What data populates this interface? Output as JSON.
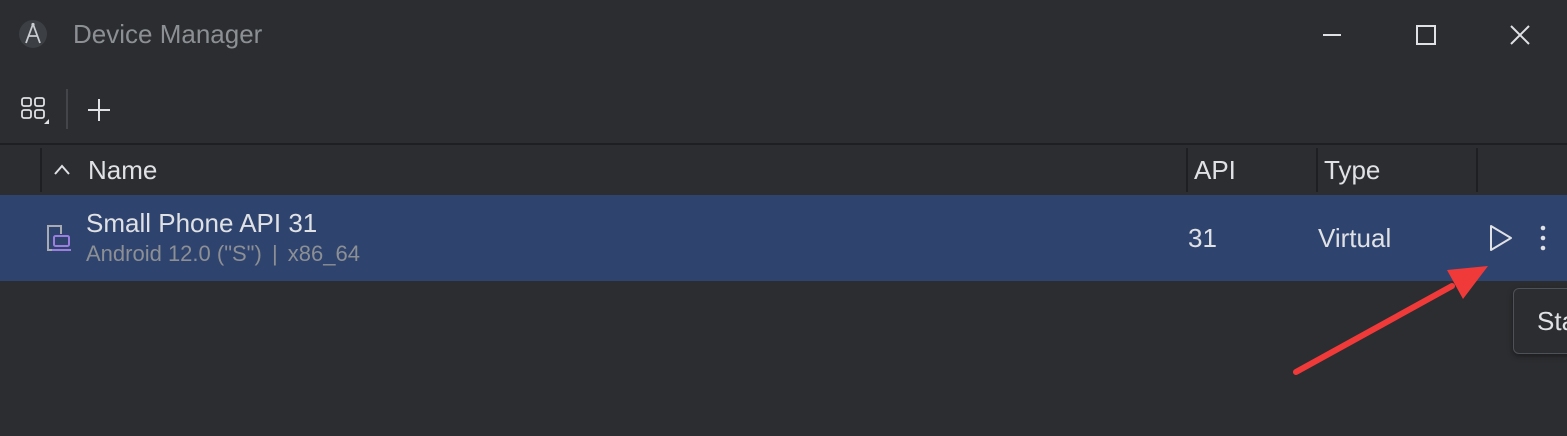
{
  "window": {
    "title": "Device Manager"
  },
  "toolbar": {
    "view_icon": "grid-view-icon",
    "add_icon": "plus-icon"
  },
  "table": {
    "columns": [
      "Name",
      "API",
      "Type"
    ],
    "sort_icon": "chevron-up-icon",
    "rows": [
      {
        "name": "Small Phone API 31",
        "android": "Android 12.0 (\"S\")",
        "arch": "x86_64",
        "api": "31",
        "type": "Virtual",
        "device_icon": "virtual-device-icon",
        "run_icon": "play-icon",
        "more_icon": "more-vertical-icon"
      }
    ]
  },
  "tooltip": {
    "text": "Sta"
  },
  "colors": {
    "background": "#2b2d30",
    "selected_row": "#2e436e",
    "device_icon_accent": "#9b7ede",
    "annotation_arrow": "#f03a3a"
  }
}
